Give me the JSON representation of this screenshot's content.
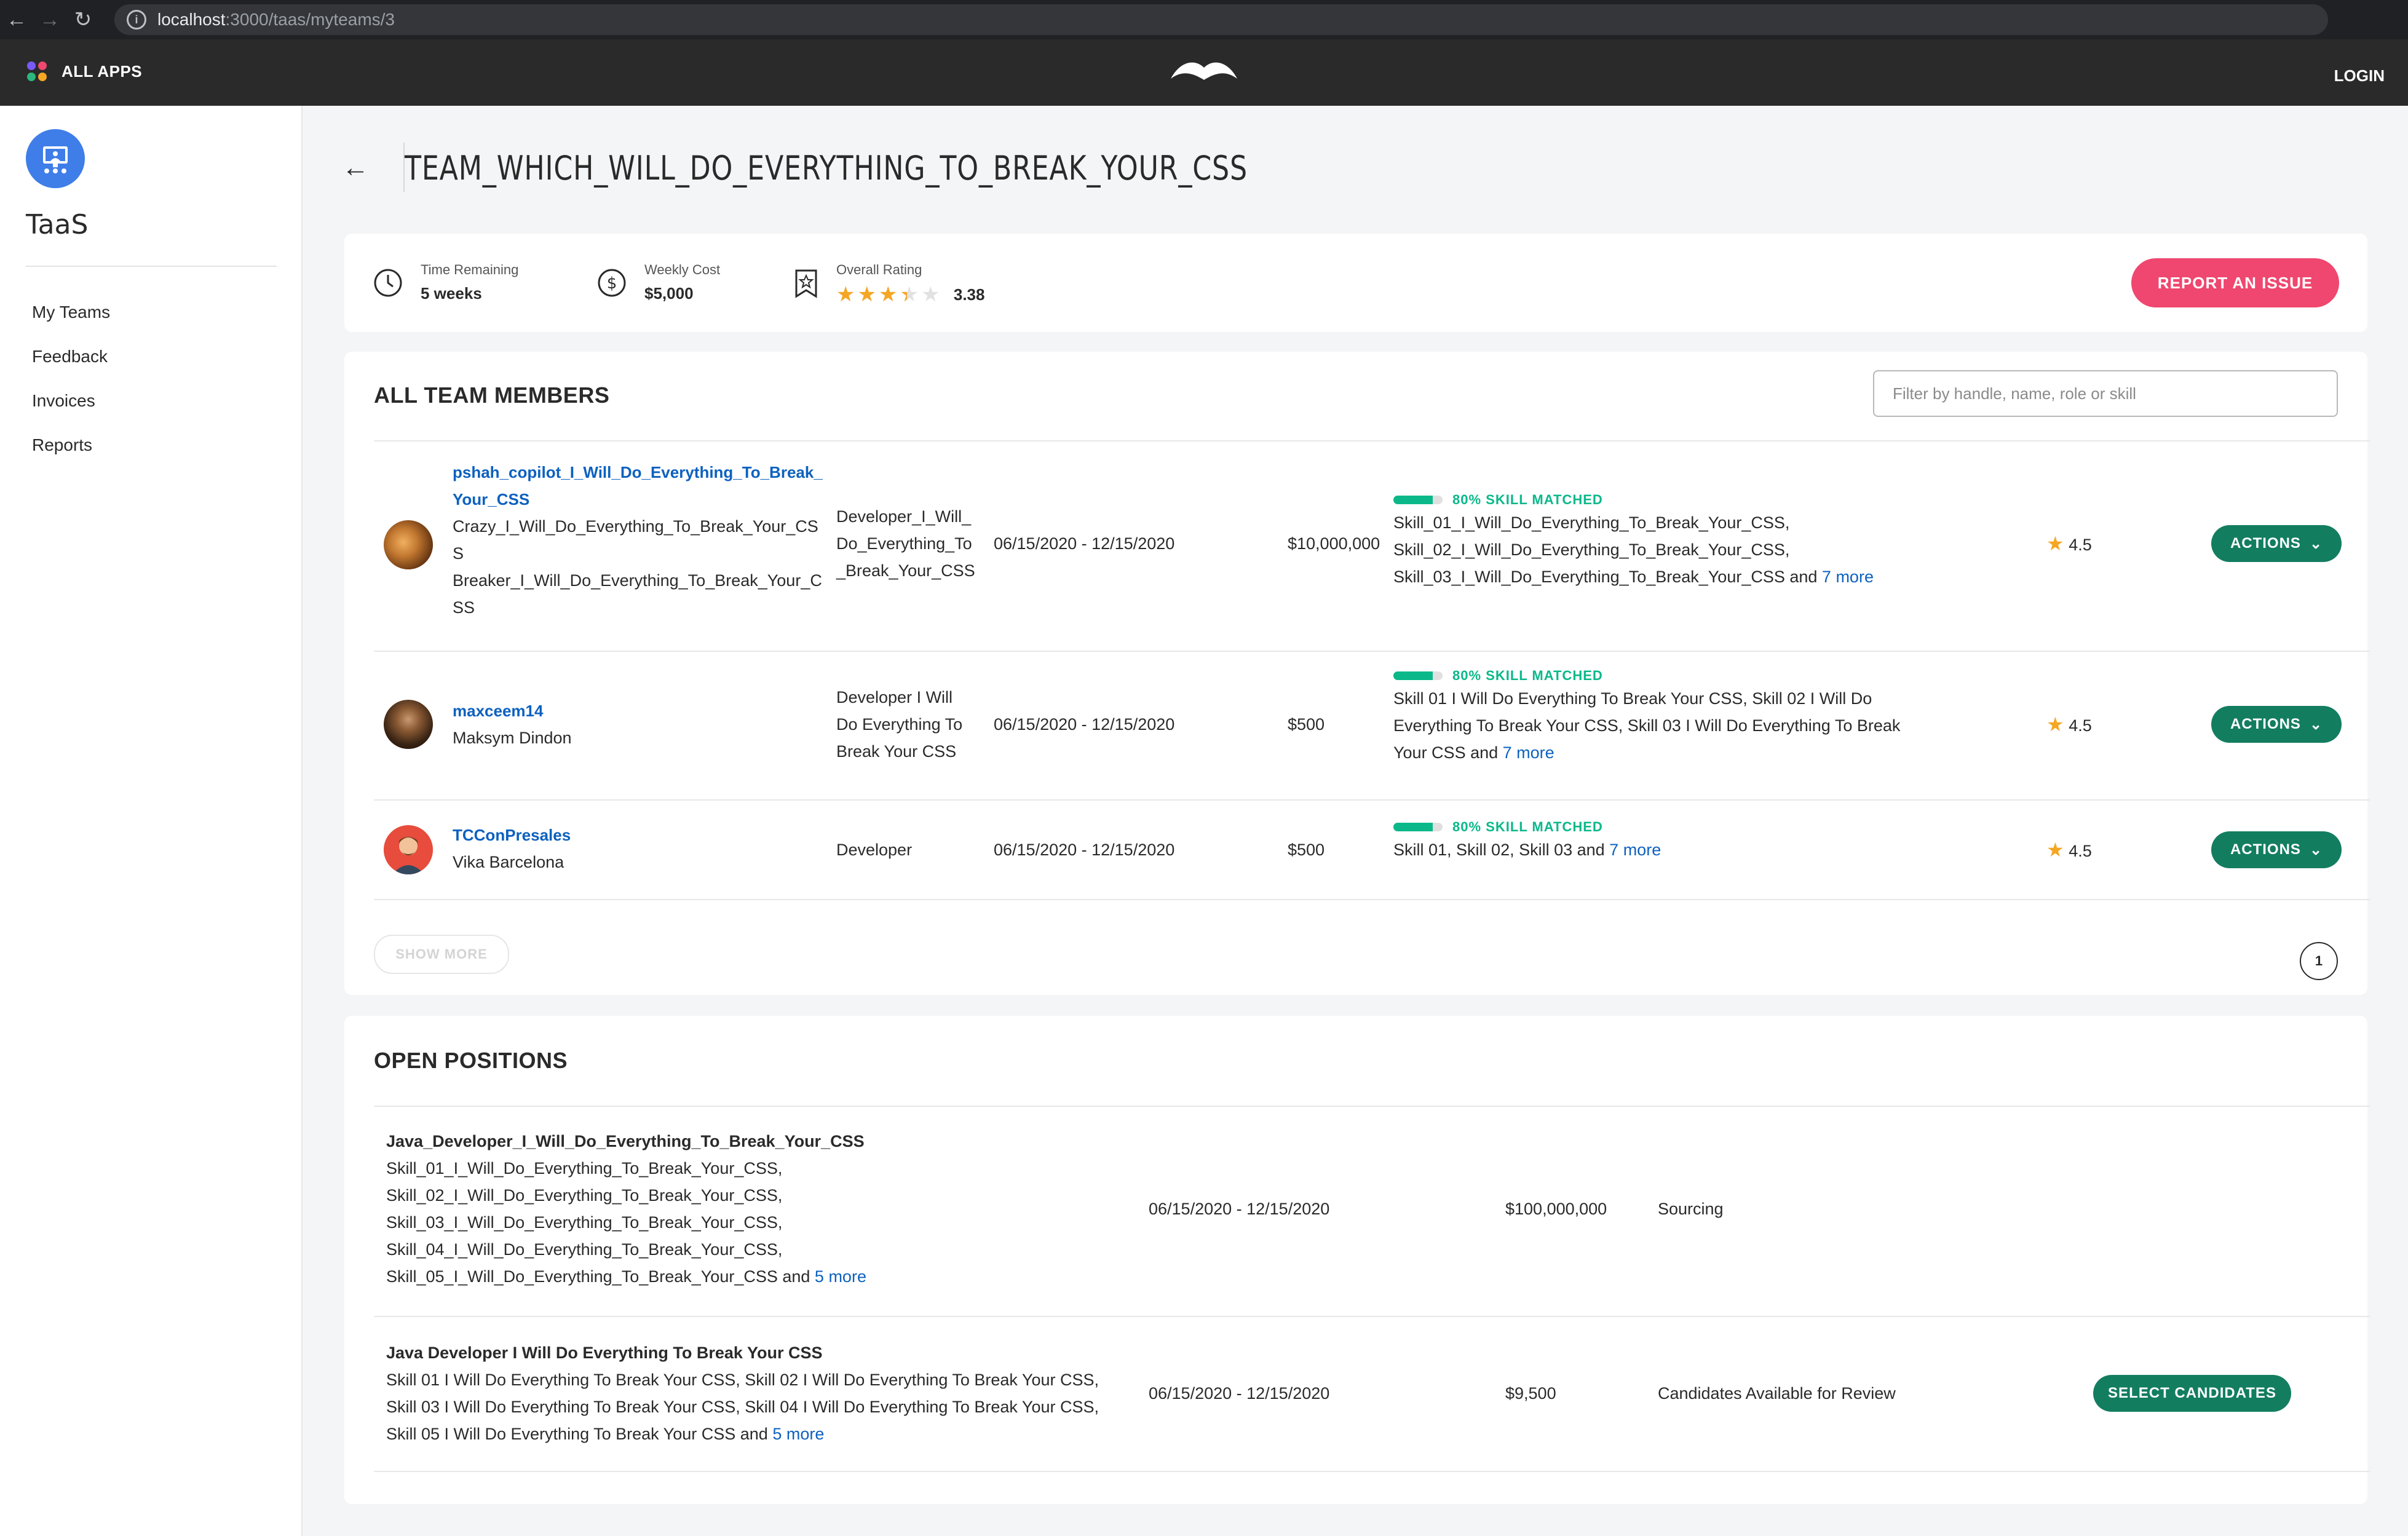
{
  "browser": {
    "url_host": "localhost",
    "url_path": ":3000/taas/myteams/3"
  },
  "topbar": {
    "all_apps_label": "ALL APPS",
    "login_label": "LOGIN"
  },
  "sidebar": {
    "app_name": "TaaS",
    "items": [
      {
        "label": "My Teams"
      },
      {
        "label": "Feedback"
      },
      {
        "label": "Invoices"
      },
      {
        "label": "Reports"
      }
    ]
  },
  "header": {
    "title": "TEAM_WHICH_WILL_DO_EVERYTHING_TO_BREAK_YOUR_CSS"
  },
  "summary": {
    "time_remaining_label": "Time Remaining",
    "time_remaining_value": "5 weeks",
    "weekly_cost_label": "Weekly Cost",
    "weekly_cost_value": "$5,000",
    "rating_label": "Overall Rating",
    "rating_value": "3.38",
    "rating_stars": 3.38,
    "report_button": "REPORT AN ISSUE"
  },
  "members": {
    "title": "ALL TEAM MEMBERS",
    "filter_placeholder": "Filter by handle, name, role or skill",
    "rows": [
      {
        "handle_line1": "pshah_copilot_I_Will_Do_Everything_To_Break_",
        "handle_line2": "Your_CSS",
        "name_lines": [
          "Crazy_I_Will_Do_Everything_To_Break_Your_CS",
          "S",
          "Breaker_I_Will_Do_Everything_To_Break_Your_C",
          "SS"
        ],
        "role_lines": [
          "Developer_I_Will_",
          "Do_Everything_To",
          "_Break_Your_CSS"
        ],
        "dates": "06/15/2020 - 12/15/2020",
        "rate": "$10,000,000",
        "match_percent": 80,
        "match_label": "80% SKILL MATCHED",
        "skills_lines": [
          "Skill_01_I_Will_Do_Everything_To_Break_Your_CSS,",
          "Skill_02_I_Will_Do_Everything_To_Break_Your_CSS,",
          "Skill_03_I_Will_Do_Everything_To_Break_Your_CSS and "
        ],
        "more": "7 more",
        "rating": "4.5",
        "actions": "ACTIONS"
      },
      {
        "handle_line1": "maxceem14",
        "name_lines": [
          "Maksym Dindon"
        ],
        "role_lines": [
          "Developer I Will",
          "Do Everything To",
          "Break Your CSS"
        ],
        "dates": "06/15/2020 - 12/15/2020",
        "rate": "$500",
        "match_percent": 80,
        "match_label": "80% SKILL MATCHED",
        "skills_lines": [
          "Skill 01 I Will Do Everything To Break Your CSS, Skill 02 I Will Do",
          "Everything To Break Your CSS, Skill 03 I Will Do Everything To Break",
          "Your CSS and "
        ],
        "more": "7 more",
        "rating": "4.5",
        "actions": "ACTIONS"
      },
      {
        "handle_line1": "TCConPresales",
        "name_lines": [
          "Vika Barcelona"
        ],
        "role_lines": [
          "Developer"
        ],
        "dates": "06/15/2020 - 12/15/2020",
        "rate": "$500",
        "match_percent": 80,
        "match_label": "80% SKILL MATCHED",
        "skills_lines": [
          "Skill 01, Skill 02, Skill 03 and "
        ],
        "more": "7 more",
        "rating": "4.5",
        "actions": "ACTIONS"
      }
    ],
    "show_more": "SHOW MORE",
    "page": "1"
  },
  "positions": {
    "title": "OPEN POSITIONS",
    "rows": [
      {
        "title": "Java_Developer_I_Will_Do_Everything_To_Break_Your_CSS",
        "skills_lines": [
          "Skill_01_I_Will_Do_Everything_To_Break_Your_CSS,",
          "Skill_02_I_Will_Do_Everything_To_Break_Your_CSS,",
          "Skill_03_I_Will_Do_Everything_To_Break_Your_CSS,",
          "Skill_04_I_Will_Do_Everything_To_Break_Your_CSS,",
          "Skill_05_I_Will_Do_Everything_To_Break_Your_CSS and "
        ],
        "more": "5 more",
        "dates": "06/15/2020 - 12/15/2020",
        "rate": "$100,000,000",
        "status": "Sourcing"
      },
      {
        "title": "Java Developer I Will Do Everything To Break Your CSS",
        "skills_lines": [
          "Skill 01 I Will Do Everything To Break Your CSS, Skill 02 I Will Do Everything To Break Your CSS,",
          "Skill 03 I Will Do Everything To Break Your CSS, Skill 04 I Will Do Everything To Break Your CSS,",
          "Skill 05 I Will Do Everything To Break Your CSS and "
        ],
        "more": "5 more",
        "dates": "06/15/2020 - 12/15/2020",
        "rate": "$9,500",
        "status": "Candidates Available for Review",
        "button": "SELECT CANDIDATES"
      }
    ]
  },
  "colors": {
    "accent_pink": "#ef476f",
    "action_green": "#137d60",
    "match_green": "#0ab88a",
    "link_blue": "#0d61bf",
    "star": "#f5a623"
  }
}
